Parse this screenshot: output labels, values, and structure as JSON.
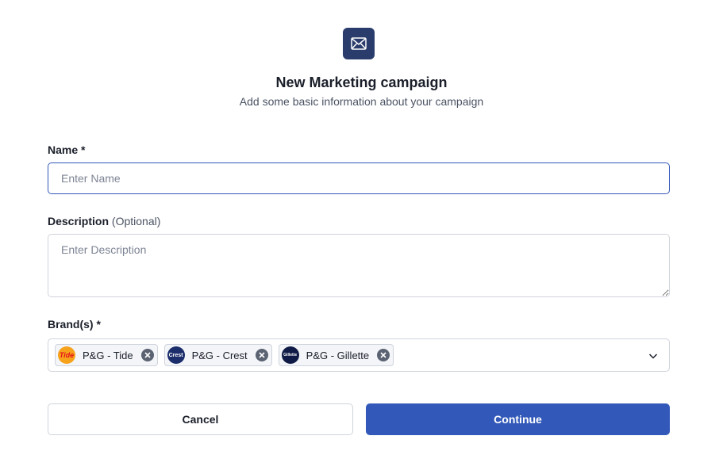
{
  "header": {
    "icon": "mail-icon",
    "title": "New Marketing campaign",
    "subtitle": "Add some basic information about your campaign"
  },
  "name_field": {
    "label": "Name *",
    "placeholder": "Enter Name",
    "value": ""
  },
  "description_field": {
    "label": "Description",
    "optional_label": "(Optional)",
    "placeholder": "Enter Description",
    "value": ""
  },
  "brands_field": {
    "label": "Brand(s) *",
    "selected": [
      {
        "label": "P&G - Tide",
        "logo_text": "Tide",
        "logo": "tide-logo"
      },
      {
        "label": "P&G - Crest",
        "logo_text": "Crest",
        "logo": "crest-logo"
      },
      {
        "label": "P&G - Gillette",
        "logo_text": "Gillette",
        "logo": "gillette-logo"
      }
    ],
    "dropdown_icon": "chevron-down-icon"
  },
  "actions": {
    "cancel_label": "Cancel",
    "continue_label": "Continue"
  },
  "colors": {
    "primary": "#3259b9",
    "icon_bg": "#2a3c6b",
    "focus_border": "#3257b8"
  }
}
